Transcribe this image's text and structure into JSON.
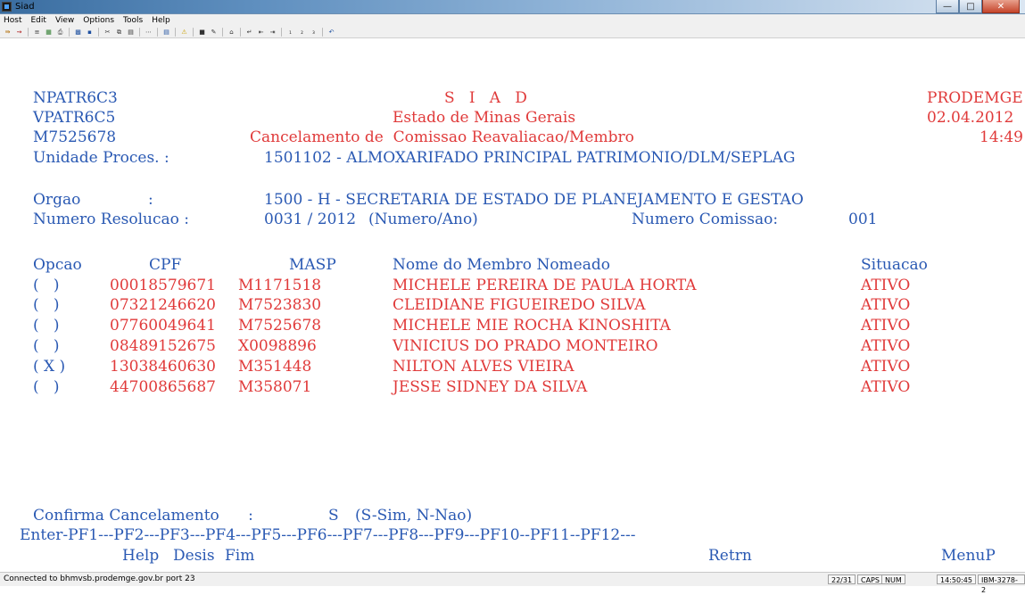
{
  "window": {
    "title": "Siad"
  },
  "menu": [
    "Host",
    "Edit",
    "View",
    "Options",
    "Tools",
    "Help"
  ],
  "header": {
    "program1": "NPATR6C3",
    "program2": "VPATR6C5",
    "masp_user": "M7525678",
    "system": "S   I   A   D",
    "state": "Estado de Minas Gerais",
    "screen_title": "Cancelamento de  Comissao Reavaliacao/Membro",
    "org": "PRODEMGE",
    "date": "02.04.2012",
    "time": "14:49",
    "unit_label": "Unidade Proces. :",
    "unit_value": "1501102 - ALMOXARIFADO PRINCIPAL PATRIMONIO/DLM/SEPLAG"
  },
  "fields": {
    "orgao_label": "Orgao              :",
    "orgao_value": "1500 - H - SECRETARIA DE ESTADO DE PLANEJAMENTO E GESTAO",
    "resolucao_label": "Numero Resolucao :",
    "resolucao_value": "0031 / 2012",
    "resolucao_hint": "(Numero/Ano)",
    "comissao_label": "Numero Comissao:",
    "comissao_value": "001"
  },
  "table": {
    "headers": {
      "opcao": "Opcao",
      "cpf": "CPF",
      "masp": "MASP",
      "nome": "Nome do Membro Nomeado",
      "situacao": "Situacao"
    },
    "rows": [
      {
        "opcao": "(   )",
        "cpf": "00018579671",
        "masp": "M1171518",
        "nome": "MICHELE PEREIRA DE PAULA HORTA",
        "situacao": "ATIVO"
      },
      {
        "opcao": "(   )",
        "cpf": "07321246620",
        "masp": "M7523830",
        "nome": "CLEIDIANE FIGUEIREDO SILVA",
        "situacao": "ATIVO"
      },
      {
        "opcao": "(   )",
        "cpf": "07760049641",
        "masp": "M7525678",
        "nome": "MICHELE MIE ROCHA KINOSHITA",
        "situacao": "ATIVO"
      },
      {
        "opcao": "(   )",
        "cpf": "08489152675",
        "masp": "X0098896",
        "nome": "VINICIUS DO PRADO MONTEIRO",
        "situacao": "ATIVO"
      },
      {
        "opcao": "( X )",
        "cpf": "13038460630",
        "masp": "M351448",
        "nome": "NILTON ALVES VIEIRA",
        "situacao": "ATIVO"
      },
      {
        "opcao": "(   )",
        "cpf": "44700865687",
        "masp": "M358071",
        "nome": "JESSE SIDNEY DA SILVA",
        "situacao": "ATIVO"
      }
    ]
  },
  "confirm": {
    "label": "Confirma Cancelamento      :",
    "value": "S",
    "hint": "(S-Sim, N-Nao)"
  },
  "pf_keys": {
    "line": "Enter-PF1---PF2---PF3---PF4---PF5---PF6---PF7---PF8---PF9---PF10--PF11--PF12---",
    "help": "Help",
    "desis": "Desis",
    "fim": "Fim",
    "retrn": "Retrn",
    "menup": "MenuP"
  },
  "status": {
    "connection": "Connected to bhmvsb.prodemge.gov.br port 23",
    "cursor": "22/31",
    "caps": "CAPS",
    "num": "NUM",
    "clock": "14:50:45",
    "terminal": "IBM-3278-2"
  },
  "colors": {
    "field_label": "#2a59b3",
    "field_value": "#e03a3a"
  }
}
